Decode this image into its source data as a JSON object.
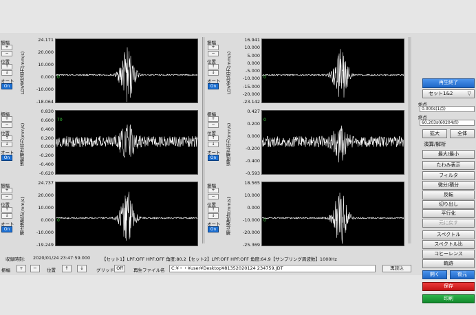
{
  "side": {
    "stop_label": "再生終了",
    "set_select": "セット1&2",
    "start_label": "始点",
    "start_value": "0.000s(1点)",
    "end_label": "終点",
    "end_value": "60.203s(60204点)",
    "zoom_label": "拡大",
    "all_label": "全体",
    "calc_heading": "演算/解析",
    "buttons": [
      "最大/最小",
      "たわみ表示",
      "フィルタ",
      "微分/積分",
      "反転",
      "切り出し",
      "平行化",
      "元に戻す",
      "スペクトル",
      "スペクトル比",
      "コヒーレンス",
      "軌跡"
    ],
    "open_label": "開く",
    "restore_label": "復元",
    "save_label": "保存",
    "print_label": "印刷"
  },
  "ctl": {
    "amp": "振幅",
    "plus": "+",
    "minus": "−",
    "pos": "位置",
    "up": "↑",
    "down": "↓",
    "auto": "オート",
    "on": "On"
  },
  "left": [
    {
      "ylabel": "LDV変位出力(mm/s)",
      "ticks": [
        "24.171",
        "20.000",
        "10.000",
        "0.000",
        "-10.000",
        "-18.064"
      ],
      "level": "0"
    },
    {
      "ylabel": "速度補正出力(mm/s)",
      "ticks": [
        "0.830",
        "0.600",
        "0.400",
        "0.200",
        "0.000",
        "-0.200",
        "-0.400",
        "-0.620"
      ],
      "level": "70"
    },
    {
      "ylabel": "補正速度計(mm/s)",
      "ticks": [
        "24.737",
        "20.000",
        "10.000",
        "0.000",
        "-10.000",
        "-19.249"
      ],
      "level": "0"
    }
  ],
  "right": [
    {
      "ylabel": "LDV変位出力(mm/s)",
      "ticks": [
        "16.941",
        "10.000",
        "5.000",
        "0.000",
        "-5.000",
        "-10.000",
        "-15.000",
        "-20.000",
        "-23.142"
      ],
      "level": "0"
    },
    {
      "ylabel": "速度補正出力(mm/s)",
      "ticks": [
        "0.427",
        "0.200",
        "0.000",
        "-0.200",
        "-0.400",
        "-0.593"
      ],
      "level": "0"
    },
    {
      "ylabel": "補正速度計(mm/s)",
      "ticks": [
        "18.565",
        "10.000",
        "0.000",
        "-10.000",
        "-20.000",
        "-25.369"
      ],
      "level": "0"
    }
  ],
  "status": {
    "rec_label": "収録時刻:",
    "rec_time": "2020/01/24 23:47:59.000",
    "info": "【セット1】LPF:OFF HPF:OFF 角度:80.2【セット2】LPF:OFF HPF:OFF 角度:64.9【サンプリング周波数】1000Hz"
  },
  "bottom": {
    "amp": "振幅",
    "plus": "+",
    "minus": "−",
    "pos": "位置",
    "up": "↑",
    "down": "↓",
    "grid_label": "グリッド",
    "grid_value": "Off",
    "file_label": "再生ファイル名",
    "file_value": "C:¥・・¥user¥Desktop¥81352020124 234759.JDT",
    "reload": "再読込"
  },
  "colors": {
    "plot_bg": "#000000",
    "trace": "#ffffff",
    "accent": "#1c6fd1"
  }
}
